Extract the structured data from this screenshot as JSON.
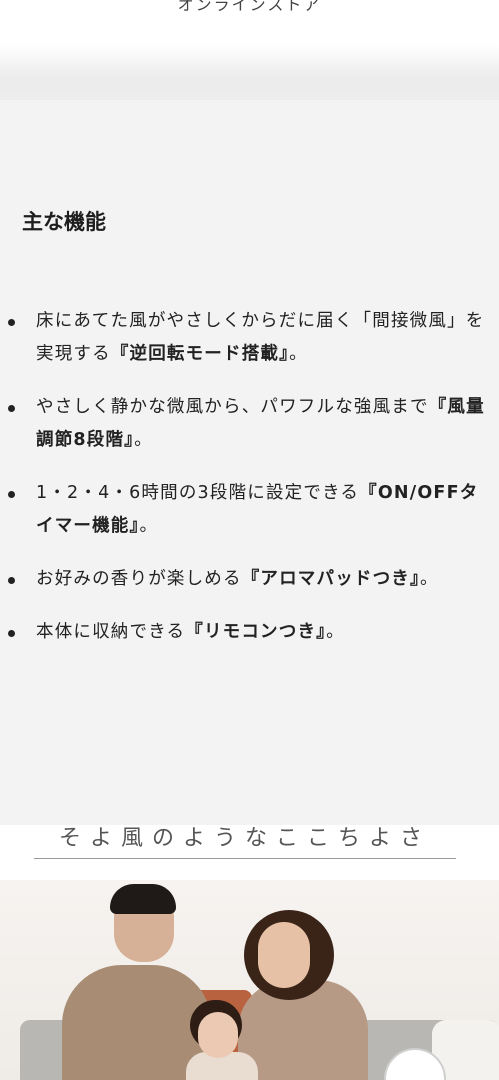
{
  "header": {
    "store_label": "オンラインストア"
  },
  "features": {
    "heading": "主な機能",
    "items": [
      {
        "text": "床にあてた風がやさしくからだに届く「間接微風」を実現する",
        "bold": "『逆回転モード搭載』",
        "tail": "。"
      },
      {
        "text": "やさしく静かな微風から、パワフルな強風まで",
        "bold": "『風量調節8段階』",
        "tail": "。"
      },
      {
        "text": "1・2・4・6時間の3段階に設定できる",
        "bold": "『ON/OFFタイマー機能』",
        "tail": "。"
      },
      {
        "text": "お好みの香りが楽しめる",
        "bold": "『アロマパッドつき』",
        "tail": "。"
      },
      {
        "text": "本体に収納できる",
        "bold": "『リモコンつき』",
        "tail": "。"
      }
    ]
  },
  "tagline": {
    "text": "そよ風のようなここちよさ"
  },
  "photo": {
    "alt_icon": "family-photo"
  }
}
